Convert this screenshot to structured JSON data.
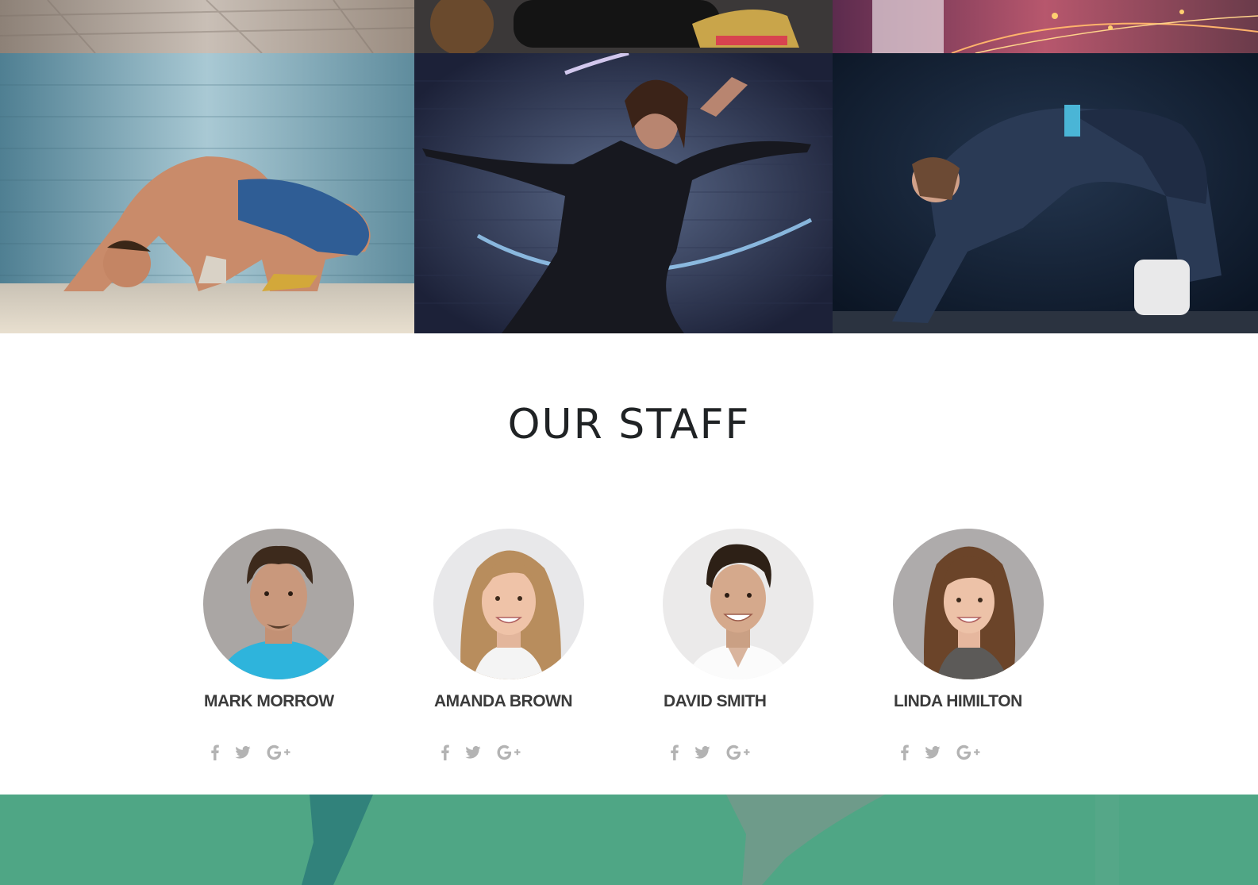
{
  "section": {
    "title": "OUR STAFF"
  },
  "staff": [
    {
      "name": "MARK MORROW",
      "shirt_color": "#2eb4dc",
      "hair_color": "#3d2a1c",
      "bg_color": "#a9a5a3"
    },
    {
      "name": "AMANDA BROWN",
      "shirt_color": "#f4f4f4",
      "hair_color": "#b88d5d",
      "bg_color": "#e7e7e9"
    },
    {
      "name": "DAVID SMITH",
      "shirt_color": "#fbfbfb",
      "hair_color": "#2d2016",
      "bg_color": "#ebeaea"
    },
    {
      "name": "LINDA HIMILTON",
      "shirt_color": "#5c5a58",
      "hair_color": "#6b4429",
      "bg_color": "#aeabab"
    }
  ],
  "social_icons": [
    "facebook-icon",
    "twitter-icon",
    "google-plus-icon"
  ],
  "colors": {
    "title": "#202325",
    "name": "#3b3b3b",
    "social": "#b3b3b3",
    "footer_band": "#4fa685"
  }
}
